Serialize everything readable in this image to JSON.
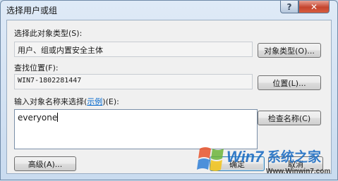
{
  "window": {
    "title": "选择用户或组",
    "help": "?",
    "close": "x"
  },
  "object_type": {
    "label": "选择此对象类型(S):",
    "value": "用户、组或内置安全主体",
    "button": "对象类型(O)..."
  },
  "location": {
    "label": "查找位置(F):",
    "value": "WIN7-1802281447",
    "button": "位置(L)..."
  },
  "names": {
    "label_prefix": "输入对象名称来选择(",
    "label_link": "示例",
    "label_suffix": ")(E):",
    "value": "everyone",
    "check_button": "检查名称(C)"
  },
  "footer": {
    "advanced": "高级(A)...",
    "ok": "确定",
    "cancel": "取消"
  },
  "watermark": {
    "brand": "Win7系统之家",
    "url": "Www.Winwin7.com"
  }
}
